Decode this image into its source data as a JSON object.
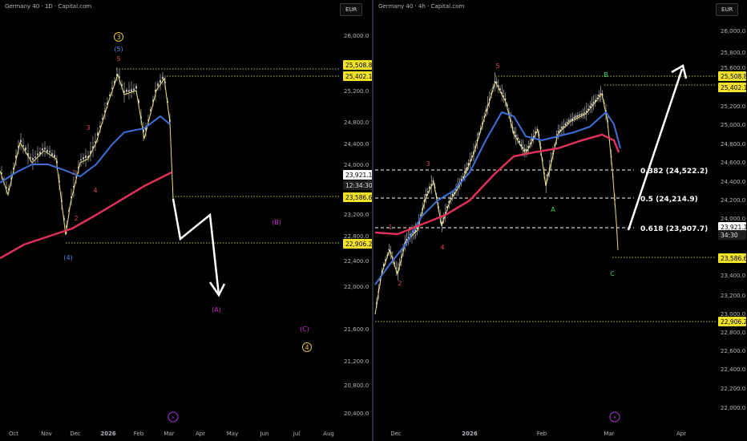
{
  "left": {
    "title": "Germany 40 · 1D · Capital.com",
    "currency": "EUR",
    "y_ticks": [
      "26,000.0",
      "25,200.0",
      "24,800.0",
      "24,400.0",
      "24,000.0",
      "23,200.0",
      "22,800.0",
      "22,400.0",
      "22,000.0",
      "21,600.0",
      "21,200.0",
      "20,800.0",
      "20,400.0"
    ],
    "x_ticks": [
      "Oct",
      "Nov",
      "Dec",
      "2026",
      "Feb",
      "Mar",
      "Apr",
      "May",
      "Jun",
      "Jul",
      "Aug"
    ],
    "price_badges": [
      {
        "text": "25,508.8",
        "kind": "yellow"
      },
      {
        "text": "25,402.1",
        "kind": "yellow"
      },
      {
        "text": "23,921.1",
        "kind": "white"
      },
      {
        "text": "12:34:30",
        "kind": "white2"
      },
      {
        "text": "23,586.6",
        "kind": "yellow"
      },
      {
        "text": "22,906.2",
        "kind": "yellow"
      }
    ],
    "wave_labels": [
      {
        "text": "3",
        "color": "#e6c34a",
        "circled": true
      },
      {
        "text": "(5)",
        "color": "#4f8be0"
      },
      {
        "text": "5",
        "color": "#e0445a"
      },
      {
        "text": "3",
        "color": "#e0445a"
      },
      {
        "text": "1",
        "color": "#e0445a"
      },
      {
        "text": "4",
        "color": "#e0445a"
      },
      {
        "text": "2",
        "color": "#e0445a"
      },
      {
        "text": "(4)",
        "color": "#4f8be0"
      },
      {
        "text": "(B)",
        "color": "#cc33cc"
      },
      {
        "text": "(A)",
        "color": "#cc33cc"
      },
      {
        "text": "(C)",
        "color": "#cc33cc"
      },
      {
        "text": "4",
        "color": "#e6c34a",
        "circled": true
      }
    ]
  },
  "right": {
    "title": "Germany 40 · 4h · Capital.com",
    "currency": "EUR",
    "y_ticks": [
      "26,000.0",
      "25,800.0",
      "25,600.0",
      "25,200.0",
      "25,000.0",
      "24,800.0",
      "24,600.0",
      "24,400.0",
      "24,200.0",
      "24,000.0",
      "23,400.0",
      "23,200.0",
      "23,000.0",
      "22,800.0",
      "22,600.0",
      "22,400.0",
      "22,200.0",
      "22,000.0"
    ],
    "x_ticks": [
      "Dec",
      "2026",
      "Feb",
      "Mar",
      "Apr"
    ],
    "price_badges": [
      {
        "text": "25,508.8",
        "kind": "yellow"
      },
      {
        "text": "25,402.1",
        "kind": "yellow"
      },
      {
        "text": "23,921.1",
        "kind": "white"
      },
      {
        "text": "34:30",
        "kind": "white2"
      },
      {
        "text": "23,586.6",
        "kind": "yellow"
      },
      {
        "text": "22,906.2",
        "kind": "yellow"
      }
    ],
    "fib_levels": [
      {
        "text": "0.382 (24,522.2)"
      },
      {
        "text": "0.5 (24,214.9)"
      },
      {
        "text": "0.618 (23,907.7)"
      }
    ],
    "wave_labels": [
      {
        "text": "5",
        "color": "#e0445a"
      },
      {
        "text": "B",
        "color": "#2fd65a"
      },
      {
        "text": "3",
        "color": "#e0445a"
      },
      {
        "text": "A",
        "color": "#2fd65a"
      },
      {
        "text": "1",
        "color": "#e0445a"
      },
      {
        "text": "4",
        "color": "#e0445a"
      },
      {
        "text": "2",
        "color": "#e0445a"
      },
      {
        "text": "C",
        "color": "#2fd65a"
      }
    ]
  },
  "colors": {
    "yellow_ma": "#e8e07a",
    "blue_ma": "#3f6fd8",
    "red_ma": "#e0305a",
    "badge_yellow": "#f2e227",
    "grid_dot": "#c8c04a"
  },
  "chart_data": [
    {
      "type": "line",
      "title": "Germany 40 · 1D · Capital.com",
      "x": [
        "Oct",
        "Nov",
        "Dec",
        "2026",
        "Feb",
        "Mar"
      ],
      "series": [
        {
          "values": [
            23700,
            23850,
            24000,
            23200,
            23300,
            24300,
            25500,
            25200,
            23921.1
          ]
        }
      ],
      "ylim": [
        20300,
        26200
      ]
    },
    {
      "type": "line",
      "title": "Germany 40 · 4h · Capital.com",
      "x": [
        "Dec",
        "2026",
        "Feb",
        "Mar"
      ],
      "series": [
        {
          "values": [
            23000,
            23600,
            24500,
            25300,
            24700,
            24300,
            25000,
            25400,
            24500,
            23921.1
          ]
        }
      ],
      "ylim": [
        21900,
        26100
      ]
    }
  ]
}
